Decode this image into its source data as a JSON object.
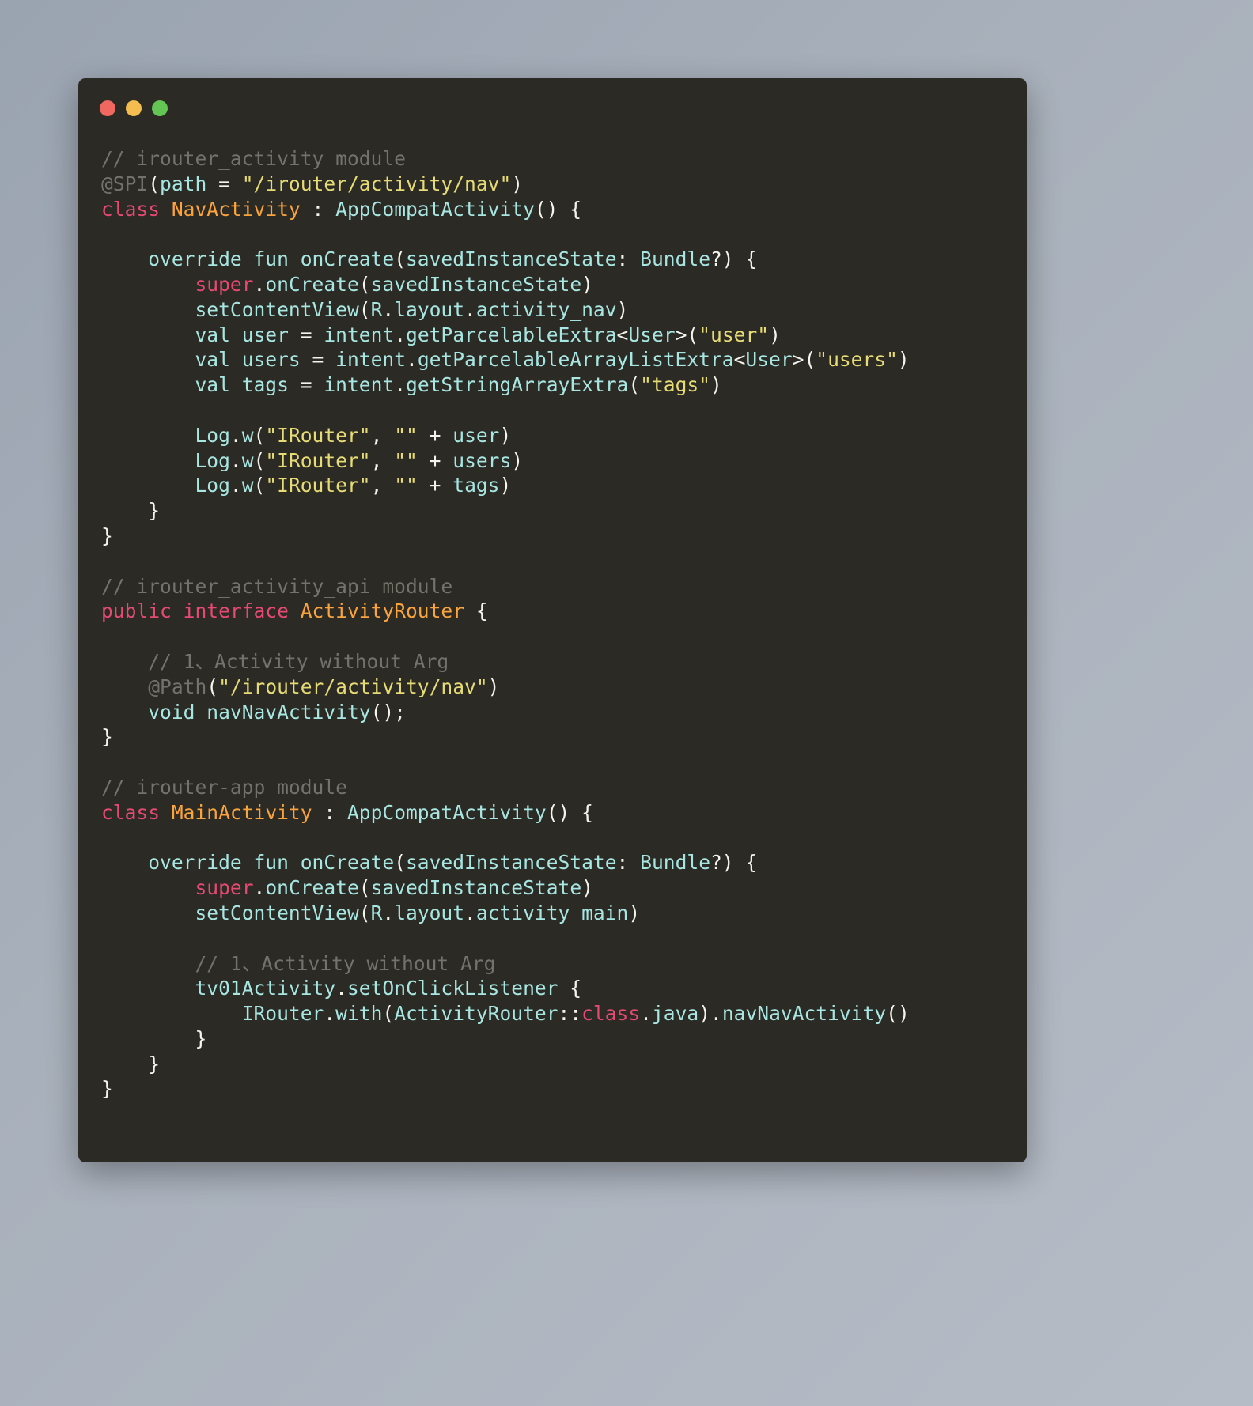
{
  "window": {
    "traffic_lights": [
      {
        "name": "close",
        "color": "#f0685f"
      },
      {
        "name": "minimize",
        "color": "#f5bd4f"
      },
      {
        "name": "maximize",
        "color": "#62c554"
      }
    ],
    "background": "#2b2a25",
    "page_background": "#a8b0bb"
  },
  "theme": {
    "comment": "#72736a",
    "keyword": "#e64a72",
    "type": "#fba33c",
    "string": "#e6db74",
    "identifier": "#a8e6e2",
    "punctuation": "#f5f3ee",
    "annotation": "#72736a"
  },
  "code": {
    "language": "kotlin-java",
    "lines": [
      [
        {
          "t": "// irouter_activity module",
          "c": "cmt"
        }
      ],
      [
        {
          "t": "@SPI",
          "c": "ann"
        },
        {
          "t": "(",
          "c": "pun"
        },
        {
          "t": "path",
          "c": "idn"
        },
        {
          "t": " = ",
          "c": "pun"
        },
        {
          "t": "\"/irouter/activity/nav\"",
          "c": "str"
        },
        {
          "t": ")",
          "c": "pun"
        }
      ],
      [
        {
          "t": "class",
          "c": "kw"
        },
        {
          "t": " ",
          "c": "pun"
        },
        {
          "t": "NavActivity",
          "c": "typ"
        },
        {
          "t": " : ",
          "c": "pun"
        },
        {
          "t": "AppCompatActivity",
          "c": "idn"
        },
        {
          "t": "() {",
          "c": "pun"
        }
      ],
      [
        {
          "t": "",
          "c": "pun"
        }
      ],
      [
        {
          "t": "    ",
          "c": "pun"
        },
        {
          "t": "override fun onCreate",
          "c": "idn"
        },
        {
          "t": "(",
          "c": "pun"
        },
        {
          "t": "savedInstanceState",
          "c": "idn"
        },
        {
          "t": ": ",
          "c": "pun"
        },
        {
          "t": "Bundle",
          "c": "idn"
        },
        {
          "t": "?) {",
          "c": "pun"
        }
      ],
      [
        {
          "t": "        ",
          "c": "pun"
        },
        {
          "t": "super",
          "c": "kw"
        },
        {
          "t": ".",
          "c": "pun"
        },
        {
          "t": "onCreate",
          "c": "idn"
        },
        {
          "t": "(",
          "c": "pun"
        },
        {
          "t": "savedInstanceState",
          "c": "idn"
        },
        {
          "t": ")",
          "c": "pun"
        }
      ],
      [
        {
          "t": "        ",
          "c": "pun"
        },
        {
          "t": "setContentView",
          "c": "idn"
        },
        {
          "t": "(",
          "c": "pun"
        },
        {
          "t": "R",
          "c": "idn"
        },
        {
          "t": ".",
          "c": "pun"
        },
        {
          "t": "layout",
          "c": "idn"
        },
        {
          "t": ".",
          "c": "pun"
        },
        {
          "t": "activity_nav",
          "c": "idn"
        },
        {
          "t": ")",
          "c": "pun"
        }
      ],
      [
        {
          "t": "        ",
          "c": "pun"
        },
        {
          "t": "val user",
          "c": "idn"
        },
        {
          "t": " = ",
          "c": "pun"
        },
        {
          "t": "intent",
          "c": "idn"
        },
        {
          "t": ".",
          "c": "pun"
        },
        {
          "t": "getParcelableExtra",
          "c": "idn"
        },
        {
          "t": "<",
          "c": "pun"
        },
        {
          "t": "User",
          "c": "idn"
        },
        {
          "t": ">(",
          "c": "pun"
        },
        {
          "t": "\"user\"",
          "c": "str"
        },
        {
          "t": ")",
          "c": "pun"
        }
      ],
      [
        {
          "t": "        ",
          "c": "pun"
        },
        {
          "t": "val users",
          "c": "idn"
        },
        {
          "t": " = ",
          "c": "pun"
        },
        {
          "t": "intent",
          "c": "idn"
        },
        {
          "t": ".",
          "c": "pun"
        },
        {
          "t": "getParcelableArrayListExtra",
          "c": "idn"
        },
        {
          "t": "<",
          "c": "pun"
        },
        {
          "t": "User",
          "c": "idn"
        },
        {
          "t": ">(",
          "c": "pun"
        },
        {
          "t": "\"users\"",
          "c": "str"
        },
        {
          "t": ")",
          "c": "pun"
        }
      ],
      [
        {
          "t": "        ",
          "c": "pun"
        },
        {
          "t": "val tags",
          "c": "idn"
        },
        {
          "t": " = ",
          "c": "pun"
        },
        {
          "t": "intent",
          "c": "idn"
        },
        {
          "t": ".",
          "c": "pun"
        },
        {
          "t": "getStringArrayExtra",
          "c": "idn"
        },
        {
          "t": "(",
          "c": "pun"
        },
        {
          "t": "\"tags\"",
          "c": "str"
        },
        {
          "t": ")",
          "c": "pun"
        }
      ],
      [
        {
          "t": "",
          "c": "pun"
        }
      ],
      [
        {
          "t": "        ",
          "c": "pun"
        },
        {
          "t": "Log",
          "c": "idn"
        },
        {
          "t": ".",
          "c": "pun"
        },
        {
          "t": "w",
          "c": "idn"
        },
        {
          "t": "(",
          "c": "pun"
        },
        {
          "t": "\"IRouter\"",
          "c": "str"
        },
        {
          "t": ", ",
          "c": "pun"
        },
        {
          "t": "\"\"",
          "c": "str"
        },
        {
          "t": " + ",
          "c": "pun"
        },
        {
          "t": "user",
          "c": "idn"
        },
        {
          "t": ")",
          "c": "pun"
        }
      ],
      [
        {
          "t": "        ",
          "c": "pun"
        },
        {
          "t": "Log",
          "c": "idn"
        },
        {
          "t": ".",
          "c": "pun"
        },
        {
          "t": "w",
          "c": "idn"
        },
        {
          "t": "(",
          "c": "pun"
        },
        {
          "t": "\"IRouter\"",
          "c": "str"
        },
        {
          "t": ", ",
          "c": "pun"
        },
        {
          "t": "\"\"",
          "c": "str"
        },
        {
          "t": " + ",
          "c": "pun"
        },
        {
          "t": "users",
          "c": "idn"
        },
        {
          "t": ")",
          "c": "pun"
        }
      ],
      [
        {
          "t": "        ",
          "c": "pun"
        },
        {
          "t": "Log",
          "c": "idn"
        },
        {
          "t": ".",
          "c": "pun"
        },
        {
          "t": "w",
          "c": "idn"
        },
        {
          "t": "(",
          "c": "pun"
        },
        {
          "t": "\"IRouter\"",
          "c": "str"
        },
        {
          "t": ", ",
          "c": "pun"
        },
        {
          "t": "\"\"",
          "c": "str"
        },
        {
          "t": " + ",
          "c": "pun"
        },
        {
          "t": "tags",
          "c": "idn"
        },
        {
          "t": ")",
          "c": "pun"
        }
      ],
      [
        {
          "t": "    }",
          "c": "pun"
        }
      ],
      [
        {
          "t": "}",
          "c": "pun"
        }
      ],
      [
        {
          "t": "",
          "c": "pun"
        }
      ],
      [
        {
          "t": "// irouter_activity_api module",
          "c": "cmt"
        }
      ],
      [
        {
          "t": "public interface",
          "c": "kw"
        },
        {
          "t": " ",
          "c": "pun"
        },
        {
          "t": "ActivityRouter",
          "c": "typ"
        },
        {
          "t": " {",
          "c": "pun"
        }
      ],
      [
        {
          "t": "",
          "c": "pun"
        }
      ],
      [
        {
          "t": "    ",
          "c": "pun"
        },
        {
          "t": "// 1、Activity without Arg",
          "c": "cmt"
        }
      ],
      [
        {
          "t": "    ",
          "c": "pun"
        },
        {
          "t": "@Path",
          "c": "ann"
        },
        {
          "t": "(",
          "c": "pun"
        },
        {
          "t": "\"/irouter/activity/nav\"",
          "c": "str"
        },
        {
          "t": ")",
          "c": "pun"
        }
      ],
      [
        {
          "t": "    ",
          "c": "pun"
        },
        {
          "t": "void navNavActivity",
          "c": "idn"
        },
        {
          "t": "();",
          "c": "pun"
        }
      ],
      [
        {
          "t": "}",
          "c": "pun"
        }
      ],
      [
        {
          "t": "",
          "c": "pun"
        }
      ],
      [
        {
          "t": "// irouter-app module",
          "c": "cmt"
        }
      ],
      [
        {
          "t": "class",
          "c": "kw"
        },
        {
          "t": " ",
          "c": "pun"
        },
        {
          "t": "MainActivity",
          "c": "typ"
        },
        {
          "t": " : ",
          "c": "pun"
        },
        {
          "t": "AppCompatActivity",
          "c": "idn"
        },
        {
          "t": "() {",
          "c": "pun"
        }
      ],
      [
        {
          "t": "",
          "c": "pun"
        }
      ],
      [
        {
          "t": "    ",
          "c": "pun"
        },
        {
          "t": "override fun onCreate",
          "c": "idn"
        },
        {
          "t": "(",
          "c": "pun"
        },
        {
          "t": "savedInstanceState",
          "c": "idn"
        },
        {
          "t": ": ",
          "c": "pun"
        },
        {
          "t": "Bundle",
          "c": "idn"
        },
        {
          "t": "?) {",
          "c": "pun"
        }
      ],
      [
        {
          "t": "        ",
          "c": "pun"
        },
        {
          "t": "super",
          "c": "kw"
        },
        {
          "t": ".",
          "c": "pun"
        },
        {
          "t": "onCreate",
          "c": "idn"
        },
        {
          "t": "(",
          "c": "pun"
        },
        {
          "t": "savedInstanceState",
          "c": "idn"
        },
        {
          "t": ")",
          "c": "pun"
        }
      ],
      [
        {
          "t": "        ",
          "c": "pun"
        },
        {
          "t": "setContentView",
          "c": "idn"
        },
        {
          "t": "(",
          "c": "pun"
        },
        {
          "t": "R",
          "c": "idn"
        },
        {
          "t": ".",
          "c": "pun"
        },
        {
          "t": "layout",
          "c": "idn"
        },
        {
          "t": ".",
          "c": "pun"
        },
        {
          "t": "activity_main",
          "c": "idn"
        },
        {
          "t": ")",
          "c": "pun"
        }
      ],
      [
        {
          "t": "",
          "c": "pun"
        }
      ],
      [
        {
          "t": "        ",
          "c": "pun"
        },
        {
          "t": "// 1、Activity without Arg",
          "c": "cmt"
        }
      ],
      [
        {
          "t": "        ",
          "c": "pun"
        },
        {
          "t": "tv01Activity",
          "c": "idn"
        },
        {
          "t": ".",
          "c": "pun"
        },
        {
          "t": "setOnClickListener",
          "c": "idn"
        },
        {
          "t": " {",
          "c": "pun"
        }
      ],
      [
        {
          "t": "            ",
          "c": "pun"
        },
        {
          "t": "IRouter",
          "c": "idn"
        },
        {
          "t": ".",
          "c": "pun"
        },
        {
          "t": "with",
          "c": "idn"
        },
        {
          "t": "(",
          "c": "pun"
        },
        {
          "t": "ActivityRouter",
          "c": "idn"
        },
        {
          "t": "::",
          "c": "pun"
        },
        {
          "t": "class",
          "c": "kw"
        },
        {
          "t": ".",
          "c": "pun"
        },
        {
          "t": "java",
          "c": "idn"
        },
        {
          "t": ").",
          "c": "pun"
        },
        {
          "t": "navNavActivity",
          "c": "idn"
        },
        {
          "t": "()",
          "c": "pun"
        }
      ],
      [
        {
          "t": "        }",
          "c": "pun"
        }
      ],
      [
        {
          "t": "    }",
          "c": "pun"
        }
      ],
      [
        {
          "t": "}",
          "c": "pun"
        }
      ]
    ]
  }
}
